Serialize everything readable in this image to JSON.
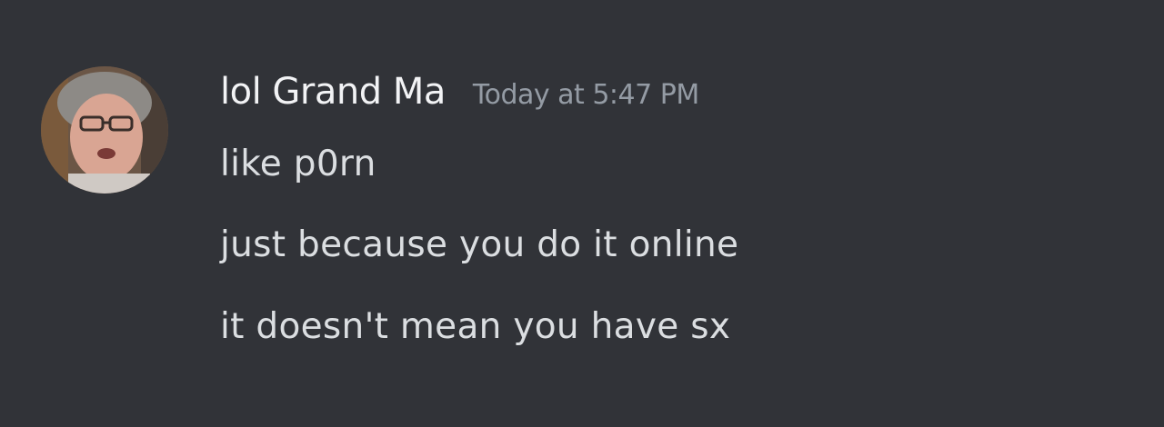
{
  "message": {
    "username": "lol Grand Ma",
    "timestamp": "Today at 5:47 PM",
    "lines": [
      "like p0rn",
      "just because you do it online",
      "it doesn't mean you have sx"
    ]
  },
  "colors": {
    "background": "#313338",
    "username": "#f2f3f5",
    "timestamp": "#949ba4",
    "text": "#dbdee1"
  }
}
